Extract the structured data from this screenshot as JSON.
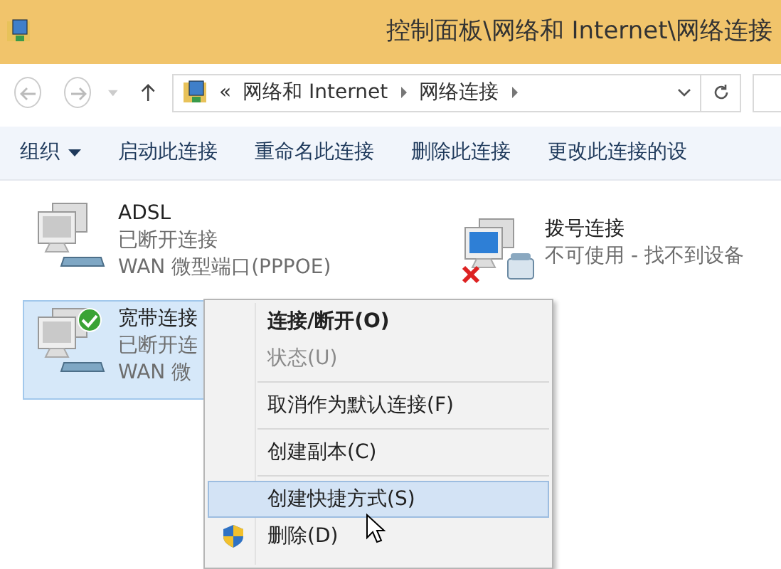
{
  "window": {
    "title": "控制面板\\网络和 Internet\\网络连接"
  },
  "address_bar": {
    "overflow": "«",
    "crumbs": [
      "网络和 Internet",
      "网络连接"
    ]
  },
  "toolbar": [
    {
      "label": "组织",
      "dropdown": true
    },
    {
      "label": "启动此连接",
      "dropdown": false
    },
    {
      "label": "重命名此连接",
      "dropdown": false
    },
    {
      "label": "删除此连接",
      "dropdown": false
    },
    {
      "label": "更改此连接的设",
      "dropdown": false
    }
  ],
  "connections": [
    {
      "name": "ADSL",
      "status": "已断开连接",
      "device": "WAN 微型端口(PPPOE)",
      "kind": "modem",
      "ok_badge": false,
      "error_badge": false,
      "selected": false
    },
    {
      "name": "拨号连接",
      "status": "不可使用 - 找不到设备",
      "kind": "phone",
      "ok_badge": false,
      "error_badge": true,
      "selected": false
    },
    {
      "name": "宽带连接",
      "status": "已断开连",
      "device": "WAN 微",
      "kind": "modem",
      "ok_badge": true,
      "error_badge": false,
      "selected": true
    }
  ],
  "context_menu": [
    {
      "kind": "item",
      "label": "连接/断开(O)",
      "default": true,
      "disabled": false,
      "selected": false
    },
    {
      "kind": "item",
      "label": "状态(U)",
      "default": false,
      "disabled": true,
      "selected": false
    },
    {
      "kind": "separator"
    },
    {
      "kind": "item",
      "label": "取消作为默认连接(F)",
      "default": false,
      "disabled": false,
      "selected": false
    },
    {
      "kind": "separator"
    },
    {
      "kind": "item",
      "label": "创建副本(C)",
      "default": false,
      "disabled": false,
      "selected": false
    },
    {
      "kind": "separator"
    },
    {
      "kind": "item",
      "label": "创建快捷方式(S)",
      "default": false,
      "disabled": false,
      "selected": true
    },
    {
      "kind": "item",
      "label": "删除(D)",
      "default": false,
      "disabled": false,
      "selected": false,
      "shield": true
    }
  ]
}
